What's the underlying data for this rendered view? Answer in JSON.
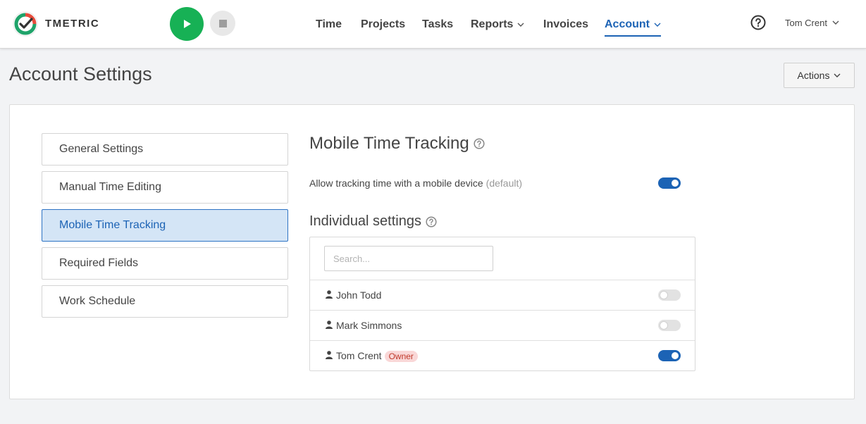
{
  "header": {
    "brand": "TMETRIC",
    "nav": [
      {
        "label": "Time"
      },
      {
        "label": "Projects"
      },
      {
        "label": "Tasks"
      },
      {
        "label": "Reports"
      },
      {
        "label": "Invoices"
      },
      {
        "label": "Account"
      }
    ],
    "active_nav": "Account",
    "user_name": "Tom Crent"
  },
  "page": {
    "title": "Account Settings",
    "actions_label": "Actions"
  },
  "sidebar": {
    "items": [
      {
        "label": "General Settings"
      },
      {
        "label": "Manual Time Editing"
      },
      {
        "label": "Mobile Time Tracking"
      },
      {
        "label": "Required Fields"
      },
      {
        "label": "Work Schedule"
      }
    ],
    "active": "Mobile Time Tracking"
  },
  "mobile": {
    "title": "Mobile Time Tracking",
    "allow_label": "Allow tracking time with a mobile device",
    "allow_note": "(default)",
    "allow_enabled": true,
    "individual_title": "Individual settings",
    "search_placeholder": "Search...",
    "users": [
      {
        "name": "John Todd",
        "badge": "",
        "enabled": false
      },
      {
        "name": "Mark Simmons",
        "badge": "",
        "enabled": false
      },
      {
        "name": "Tom Crent",
        "badge": "Owner",
        "enabled": true
      }
    ]
  },
  "colors": {
    "accent": "#1c63b5",
    "play": "#17b155",
    "active_item_bg": "#d4e5f6",
    "owner_badge_bg": "#f9d7d7"
  },
  "icons": [
    "tmetric-logo-icon",
    "play-icon",
    "stop-icon",
    "chevron-down-icon",
    "help-circle-icon",
    "person-icon"
  ]
}
